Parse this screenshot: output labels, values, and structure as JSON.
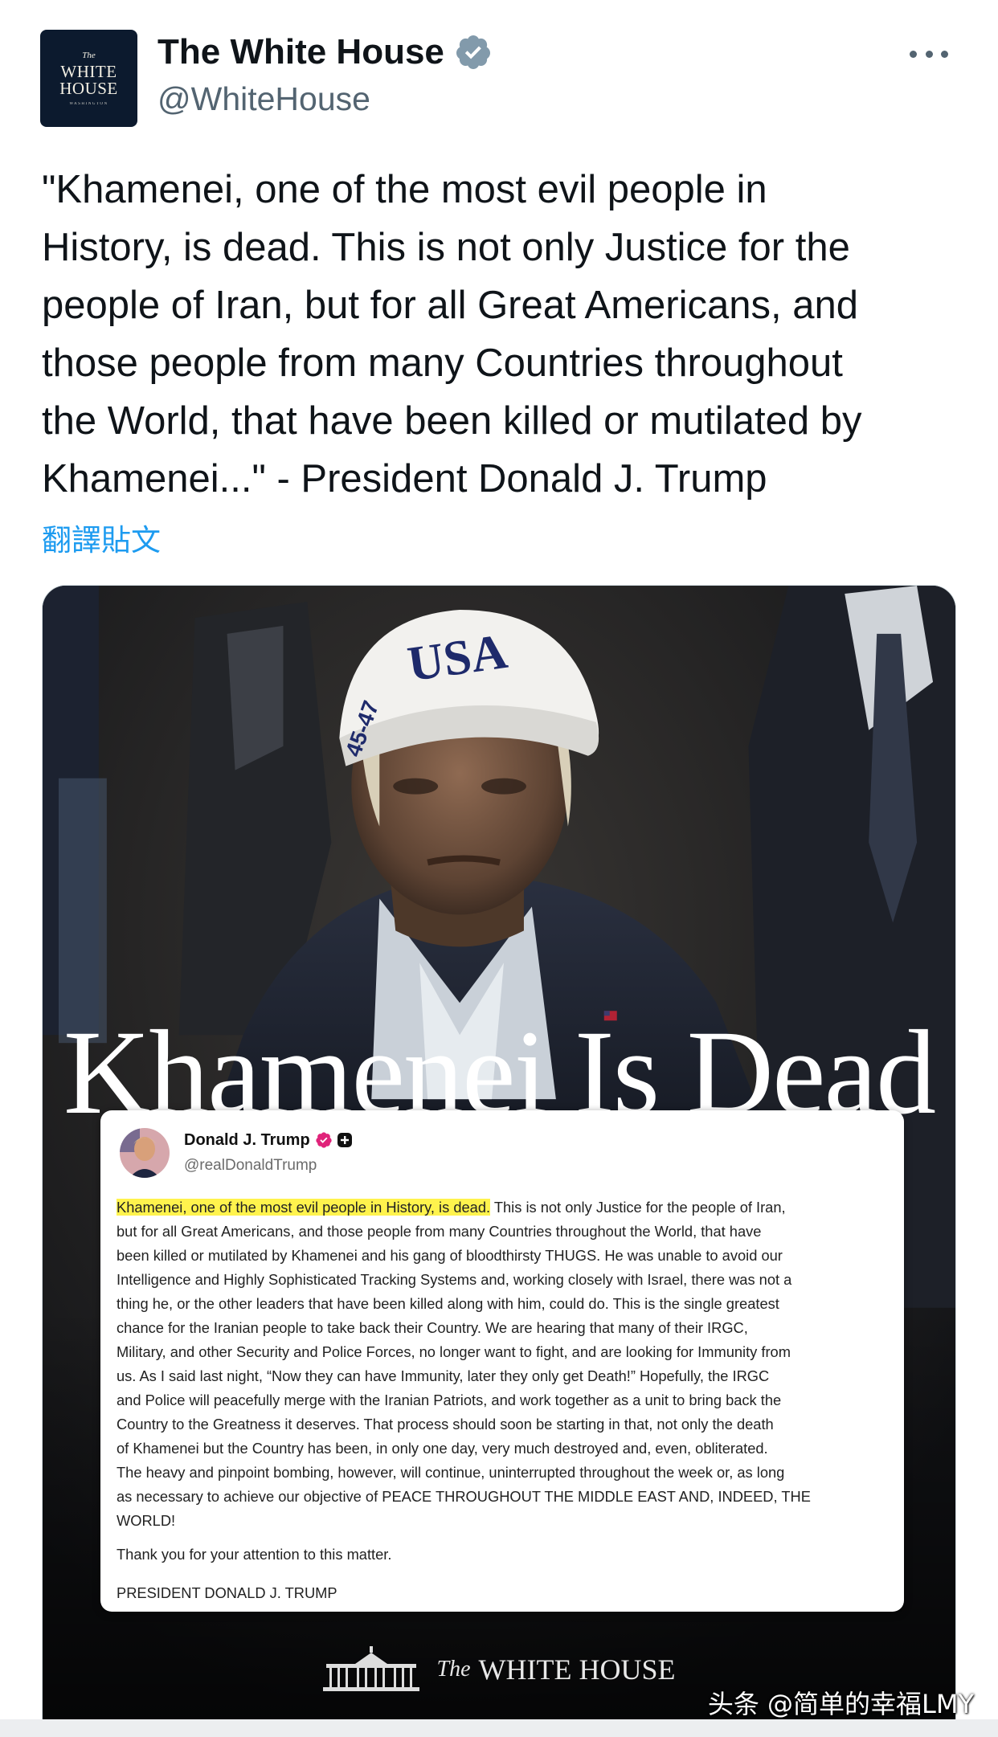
{
  "colors": {
    "name": "#0f1419",
    "handle": "#536471",
    "link": "#1d9bf0",
    "verified_gray": "#829aab",
    "highlight": "#fff34d",
    "truth_badge": "#e0237a"
  },
  "account": {
    "avatar": {
      "the": "The",
      "word1": "WHITE",
      "word2": "HOUSE",
      "sub": "WASHINGTON"
    },
    "display_name": "The White House",
    "handle": "@WhiteHouse",
    "verified_icon": "verified-badge-icon",
    "more_icon": "more-horizontal-icon"
  },
  "tweet": {
    "text": "\"Khamenei, one of the most evil people in\nHistory, is dead. This is not only Justice for the\npeople of Iran, but for all Great Americans, and\nthose people from many Countries throughout\nthe World, that have been killed or mutilated by\nKhamenei...\" - President Donald J. Trump",
    "translate_label": "翻譯貼文"
  },
  "media": {
    "hat_text": "USA",
    "headline": "Khamenei Is Dead",
    "post": {
      "name": "Donald J. Trump",
      "handle": "@realDonaldTrump",
      "highlight": "Khamenei, one of the most evil people in History, is dead.",
      "line1_rest": " This is not only Justice for the people of Iran,",
      "lines": [
        "but for all Great Americans, and those people from many Countries throughout the World, that have",
        "been killed or mutilated by Khamenei and his gang of bloodthirsty THUGS. He was unable to avoid our",
        "Intelligence and Highly Sophisticated Tracking Systems and, working closely with Israel, there was not a",
        "thing he, or the other leaders that have been killed along with him, could do. This is the single greatest",
        "chance for the Iranian people to take back their Country. We are hearing that many of their IRGC,",
        "Military, and other Security and Police Forces, no longer want to fight, and are looking for Immunity from",
        "us. As I said last night, “Now they can have Immunity, later they only get Death!” Hopefully, the IRGC",
        "and Police will peacefully merge with the Iranian Patriots, and work together as a unit to bring back the",
        "Country to the Greatness it deserves. That process should soon be starting in that, not only the death",
        "of Khamenei but the Country has been, in only one day, very much destroyed and, even, obliterated.",
        "The heavy and pinpoint bombing, however, will continue, uninterrupted throughout the week or, as long",
        "as necessary to achieve our objective of PEACE THROUGHOUT THE MIDDLE EAST AND, INDEED, THE",
        "WORLD!"
      ],
      "thanks": "Thank you for your attention to this matter.",
      "signature": "PRESIDENT DONALD J. TRUMP"
    },
    "footer": {
      "the": "The",
      "word": "WHITE HOUSE"
    }
  },
  "watermark": "头条 @简单的幸福LMY"
}
